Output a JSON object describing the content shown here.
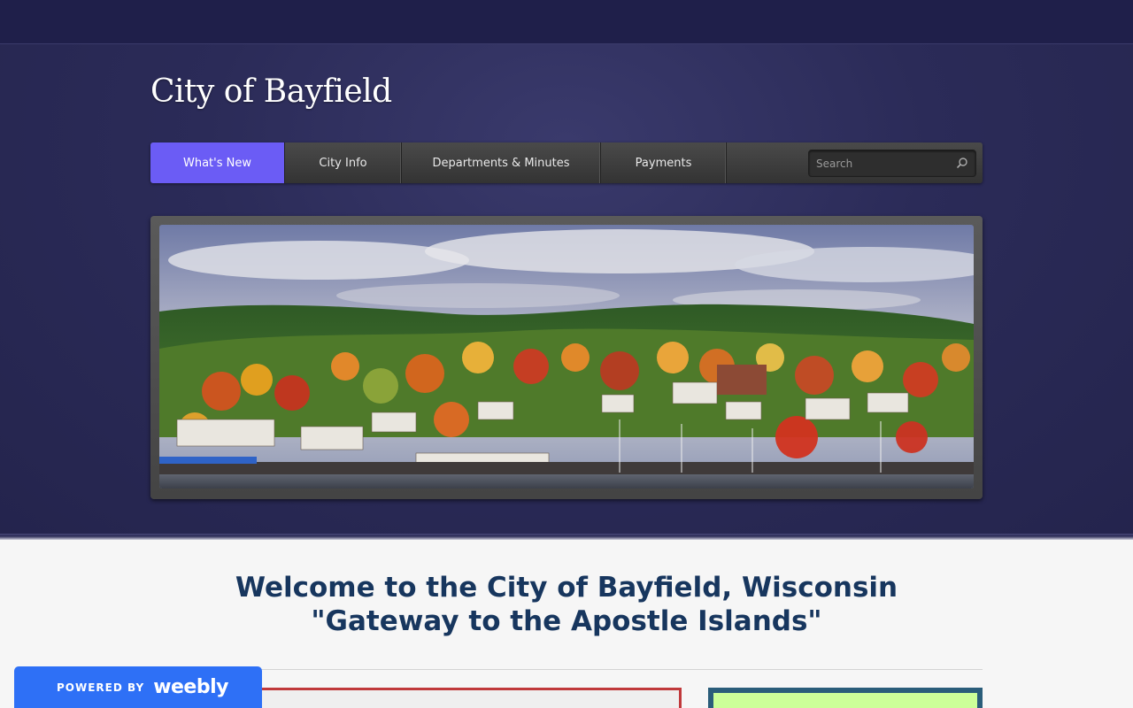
{
  "site": {
    "title": "City of Bayfield"
  },
  "nav": {
    "items": [
      {
        "label": "What's New",
        "active": true
      },
      {
        "label": "City Info",
        "active": false
      },
      {
        "label": "Departments & Minutes",
        "active": false
      },
      {
        "label": "Payments",
        "active": false
      }
    ],
    "search_placeholder": "Search",
    "search_icon": "search-icon",
    "active_color": "#6b5cf5"
  },
  "banner": {
    "alt": "Bayfield harbor with autumn foliage"
  },
  "content": {
    "welcome_line1": "Welcome to the City of Bayfield, Wisconsin",
    "welcome_line2": "\"Gateway to the Apostle Islands\""
  },
  "badge": {
    "powered_by": "POWERED BY",
    "brand": "weebly",
    "color": "#2e70f6"
  },
  "colors": {
    "header_bg": "#2b2b58",
    "heading": "#17365e"
  }
}
